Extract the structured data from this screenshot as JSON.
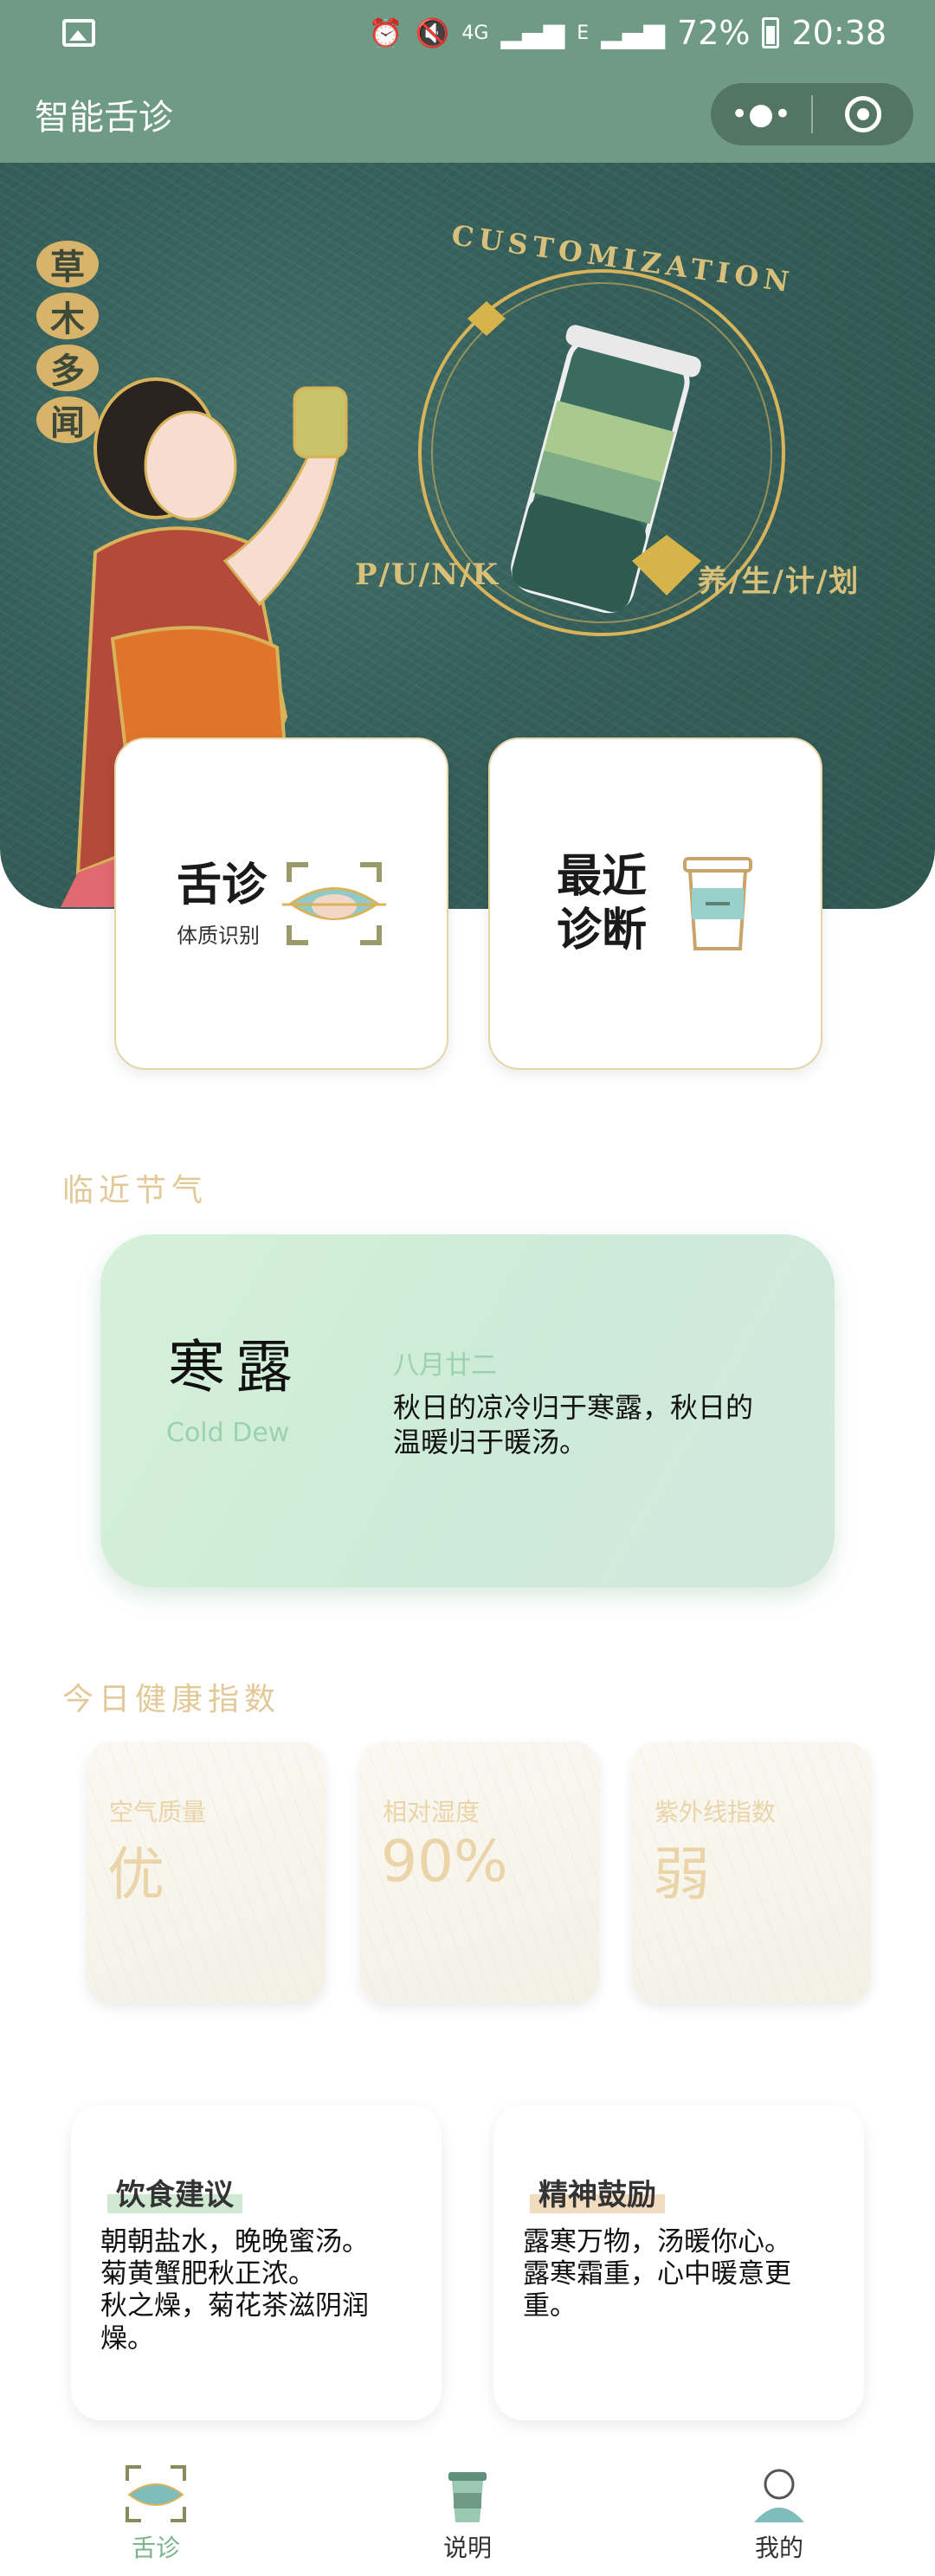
{
  "status_bar": {
    "battery": "72%",
    "time": "20:38",
    "network_4g": "4G",
    "network_e": "E"
  },
  "nav": {
    "title": "智能舌诊",
    "more_icon": "more-dots-icon",
    "close_icon": "target-icon"
  },
  "banner": {
    "brand_chars": [
      "草",
      "木",
      "多",
      "闻"
    ],
    "arc_text": "CUSTOMIZATION",
    "left_text": "P/U/N/K",
    "right_text": "养/生/计/划"
  },
  "feature_cards": {
    "tongue": {
      "title": "舌诊",
      "subtitle": "体质识别"
    },
    "recent": {
      "title_line1": "最近",
      "title_line2": "诊断"
    }
  },
  "sections": {
    "solar_term": "临近节气",
    "health_index": "今日健康指数"
  },
  "solar_term": {
    "name": "寒露",
    "english": "Cold Dew",
    "lunar_date": "八月廿二",
    "description": "秋日的凉冷归于寒露，秋日的温暖归于暖汤。"
  },
  "health": [
    {
      "label": "空气质量",
      "value": "优"
    },
    {
      "label": "相对湿度",
      "value": "90%"
    },
    {
      "label": "紫外线指数",
      "value": "弱"
    }
  ],
  "advice": {
    "diet": {
      "title": "饮食建议",
      "body_lines": [
        "朝朝盐水，晚晚蜜汤。",
        "菊黄蟹肥秋正浓。",
        "秋之燥，菊花茶滋阴润燥。"
      ]
    },
    "spirit": {
      "title": "精神鼓励",
      "body_lines": [
        "露寒万物，汤暖你心。",
        "露寒霜重，心中暖意更重。"
      ]
    }
  },
  "tabs": [
    {
      "label": "舌诊",
      "icon": "tongue-scan-icon",
      "active": true
    },
    {
      "label": "说明",
      "icon": "cup-icon",
      "active": false
    },
    {
      "label": "我的",
      "icon": "user-icon",
      "active": false
    }
  ],
  "colors": {
    "header": "#6f9a84",
    "banner": "#36605b",
    "gold": "#d9c07a",
    "section_title": "#e3c898",
    "solar_accent": "#9bd2ae",
    "tab_active": "#7cb48c"
  }
}
